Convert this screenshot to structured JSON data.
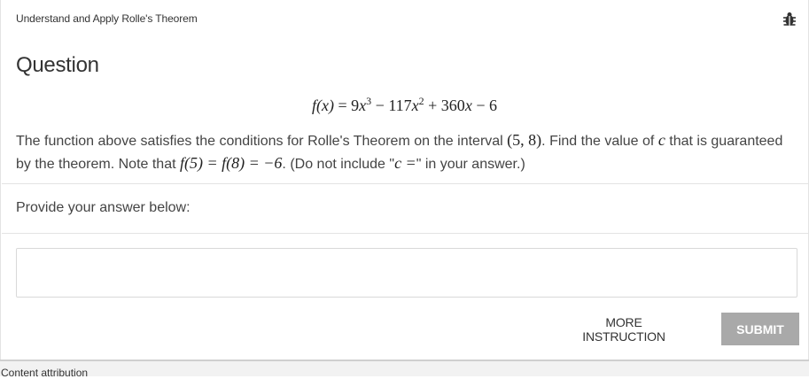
{
  "header": {
    "topic": "Understand and Apply Rolle's Theorem",
    "report_icon": "bug-icon"
  },
  "question": {
    "title": "Question",
    "formula": {
      "lhs": "f(x)",
      "equals": " = ",
      "term1_coef": "9",
      "term1_var": "x",
      "term1_exp": "3",
      "minus1": " − 117",
      "term2_var": "x",
      "term2_exp": "2",
      "plus": " + 360",
      "term3_var": "x",
      "const": " − 6"
    },
    "text_part1": "The function above satisfies the conditions for Rolle's Theorem on the interval ",
    "interval": "(5, 8)",
    "text_part2": ". Find the value of ",
    "c_var": "c",
    "text_part3": " that is guaranteed by the theorem. Note that ",
    "note_math": "f(5) = f(8) = −6",
    "text_part4": ". (Do not include \"",
    "c_equals": "c =",
    "text_part5": "\" in your answer.)"
  },
  "answer": {
    "prompt": "Provide your answer below:",
    "value": "",
    "placeholder": ""
  },
  "actions": {
    "more_instruction": "MORE INSTRUCTION",
    "submit": "SUBMIT"
  },
  "footer": {
    "attribution": "Content attribution"
  },
  "colors": {
    "submit_bg": "#a9a9a9",
    "border": "#e3e3e3",
    "text": "#333333"
  }
}
